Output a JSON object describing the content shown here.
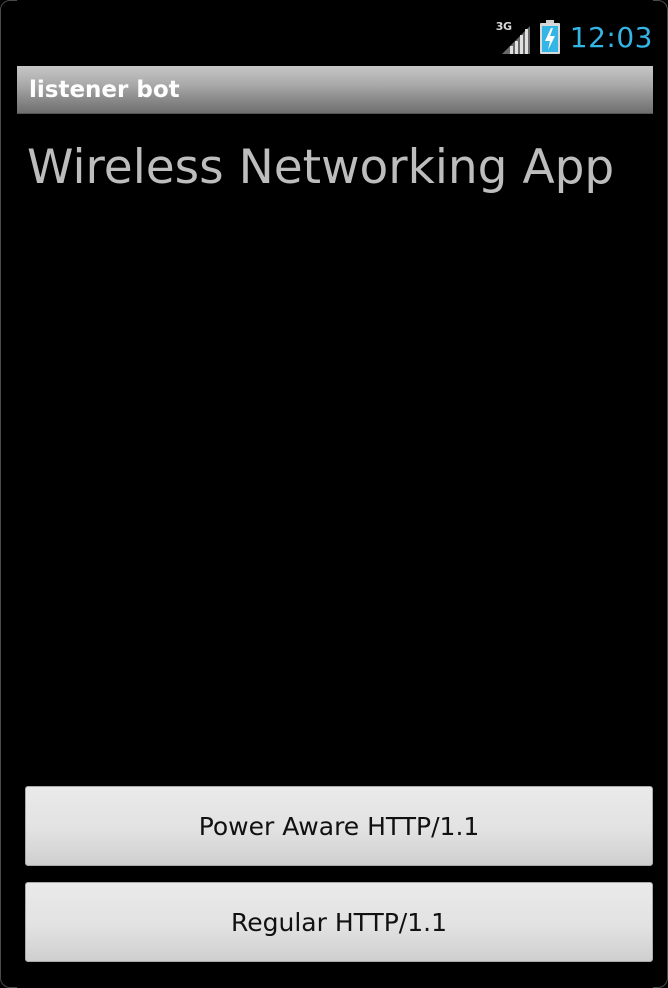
{
  "status_bar": {
    "network_label": "3G",
    "time": "12:03",
    "clock_color": "#33b5e5",
    "icons": [
      "signal-3g-icon",
      "battery-charging-icon"
    ]
  },
  "app": {
    "title": "listener bot"
  },
  "main": {
    "heading": "Wireless Networking App"
  },
  "buttons": {
    "power_aware": "Power Aware HTTP/1.1",
    "regular": "Regular HTTP/1.1"
  }
}
